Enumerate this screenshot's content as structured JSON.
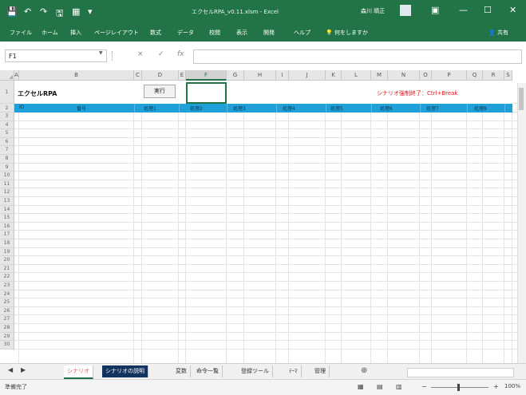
{
  "titlebar": {
    "title": "エクセルRPA_v0.11.xlsm - Excel",
    "user": "森川 晴正",
    "quick_access": [
      "💾",
      "↶",
      "↷",
      "🖫",
      "▦",
      "▾"
    ],
    "window_controls": [
      "▣",
      "—",
      "☐",
      "✕"
    ]
  },
  "ribbon": {
    "tabs": [
      "ファイル",
      "ホーム",
      "挿入",
      "ページレイアウト",
      "数式",
      "データ",
      "校閲",
      "表示",
      "開発",
      "ヘルプ"
    ],
    "tell_me": "何をしますか",
    "share": "共有"
  },
  "formula_bar": {
    "name_box": "F1",
    "icons": [
      "×",
      "✓",
      "fx"
    ],
    "formula": ""
  },
  "sheet": {
    "corner": "◢",
    "columns": [
      "A",
      "B",
      "C",
      "D",
      "E",
      "F",
      "G",
      "H",
      "I",
      "J",
      "K",
      "L",
      "M",
      "N",
      "O",
      "P",
      "Q",
      "R",
      "S"
    ],
    "selected_column": "F",
    "row_numbers": [
      "1",
      "2",
      "3",
      "4",
      "5",
      "6",
      "7",
      "8",
      "9",
      "10",
      "11",
      "12",
      "13",
      "14",
      "15",
      "16",
      "17",
      "18",
      "19",
      "20",
      "21",
      "22",
      "23",
      "24",
      "25",
      "26",
      "27",
      "28",
      "29",
      "30"
    ],
    "a1": "エクセルRPA",
    "run_button": "実行",
    "note": "シナリオ強制終了：Ctrl+Break",
    "header_row": {
      "a": "ID",
      "b": "番号",
      "steps": [
        "処理1",
        "処理2",
        "処理3",
        "処理4",
        "処理5",
        "処理6",
        "処理7",
        "処理8"
      ]
    }
  },
  "sheet_tabs": [
    "シナリオ",
    "シナリオの説明",
    "変数",
    "命令一覧",
    "登録ツール",
    "ﾃｰﾏ",
    "管理"
  ],
  "active_sheet": "シナリオ",
  "status_bar": {
    "left": "準備完了",
    "zoom": "100%"
  },
  "colors": {
    "excel_green": "#227447",
    "header_blue": "#1fa0d8",
    "note_red": "#e0181b"
  }
}
